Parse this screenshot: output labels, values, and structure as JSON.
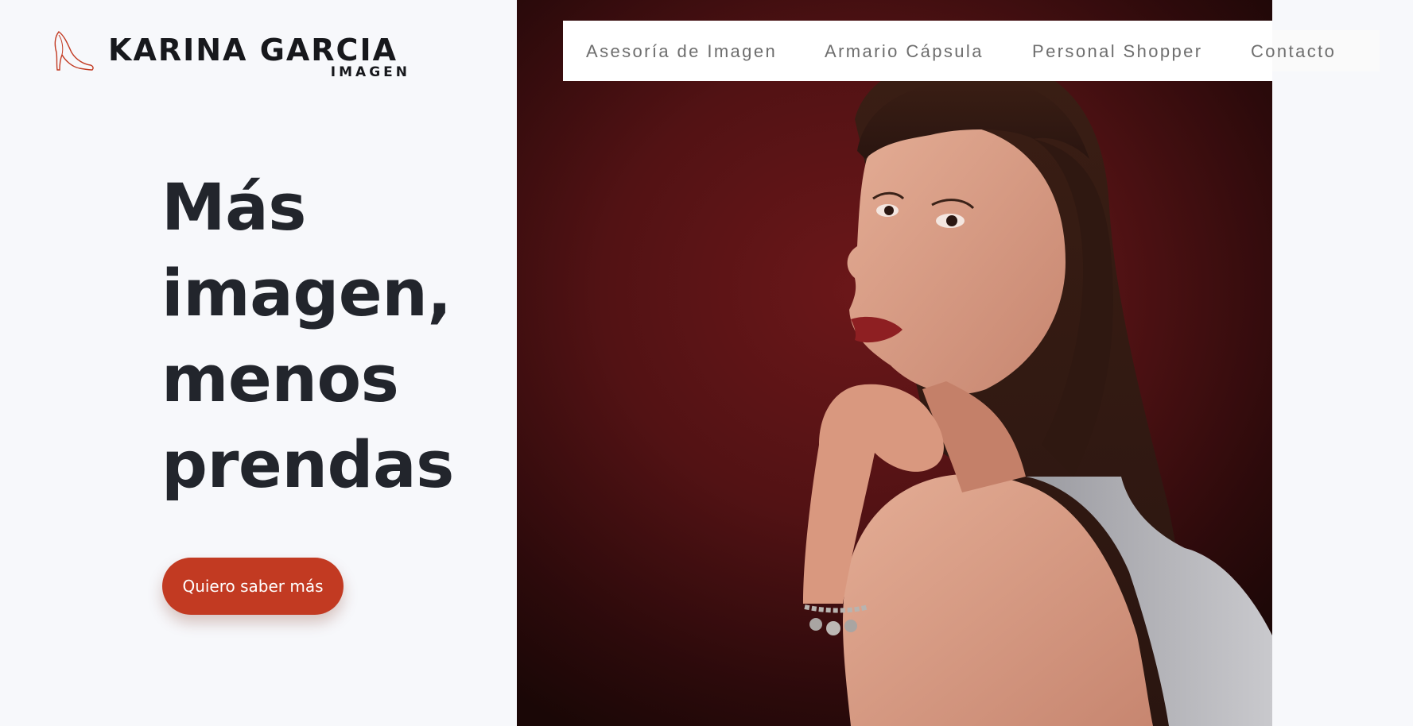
{
  "brand": {
    "name": "KARINA GARCIA",
    "subtitle": "IMAGEN",
    "logo_icon": "high-heel-shoe-icon",
    "accent_color": "#c23a22"
  },
  "nav": {
    "items": [
      {
        "label": "Asesoría de Imagen"
      },
      {
        "label": "Armario Cápsula"
      },
      {
        "label": "Personal Shopper"
      },
      {
        "label": "Contacto"
      }
    ]
  },
  "hero": {
    "headline_lines": [
      "Más",
      "imagen,",
      "menos",
      "prendas"
    ],
    "cta_label": "Quiero saber más",
    "photo_alt": "hero-portrait-photo"
  }
}
